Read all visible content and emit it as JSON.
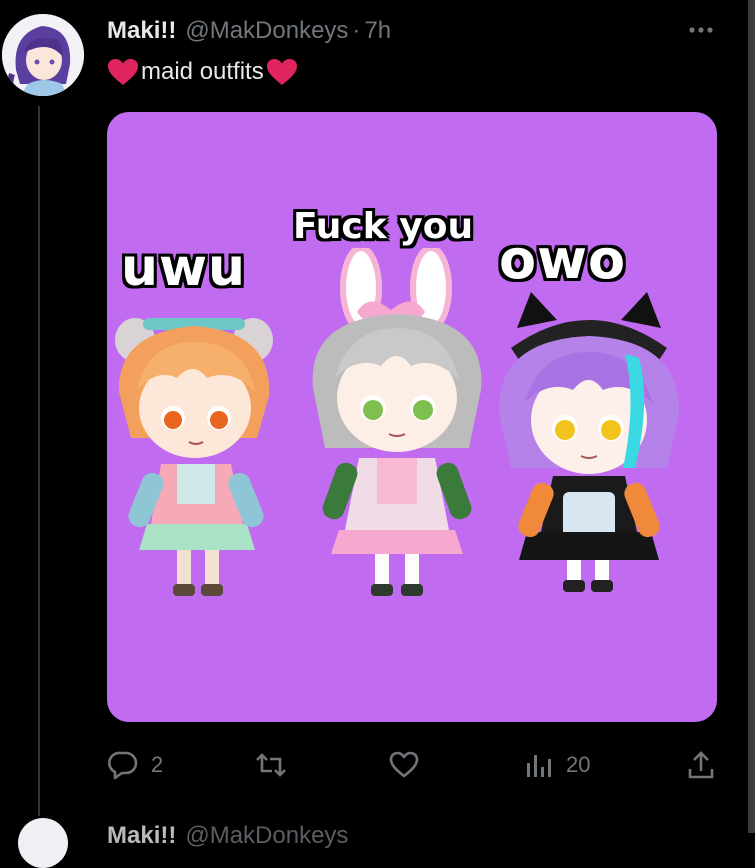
{
  "tweet": {
    "author_name": "Maki!!",
    "handle": "@MakDonkeys",
    "separator": "·",
    "time": "7h",
    "text": "maid outfits",
    "heart_emoji": "❤"
  },
  "media": {
    "background": "#c16bf1",
    "labels": {
      "left": "uwu",
      "center": "Fuck you",
      "right": "owo"
    }
  },
  "actions": {
    "replies": "2",
    "retweets": "",
    "likes": "",
    "views": "20"
  },
  "icons": [
    "avatar",
    "more-icon",
    "reply-icon",
    "retweet-icon",
    "like-icon",
    "views-icon",
    "share-icon"
  ],
  "next_tweet": {
    "author_name": "Maki!!",
    "handle": "@MakDonkeys"
  },
  "colors": {
    "background": "#000000",
    "text": "#e7e9ea",
    "muted": "#71767b",
    "heart": "#e0245e"
  }
}
